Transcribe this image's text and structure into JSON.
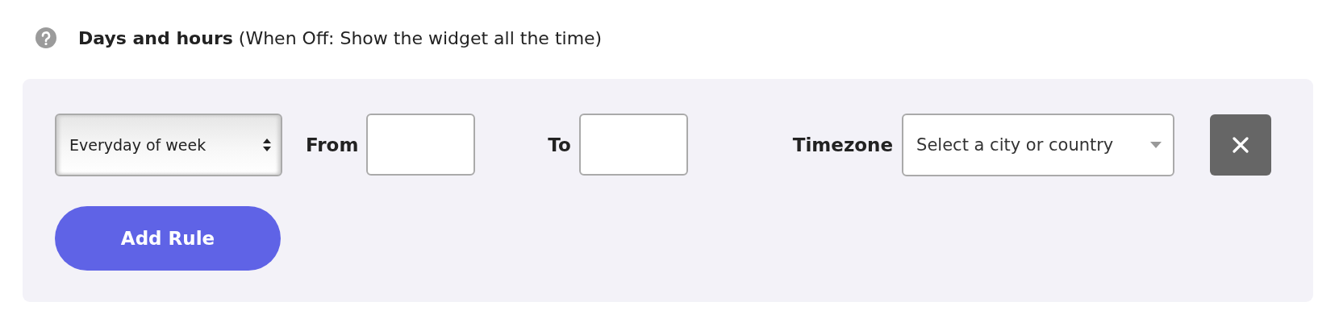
{
  "header": {
    "title": "Days and hours",
    "note": "(When Off: Show the widget all the time)"
  },
  "rules": [
    {
      "day": "Everyday of week",
      "from_label": "From",
      "to_label": "To",
      "timezone_label": "Timezone",
      "timezone_placeholder": "Select a city or country"
    }
  ],
  "add_button": "Add Rule"
}
